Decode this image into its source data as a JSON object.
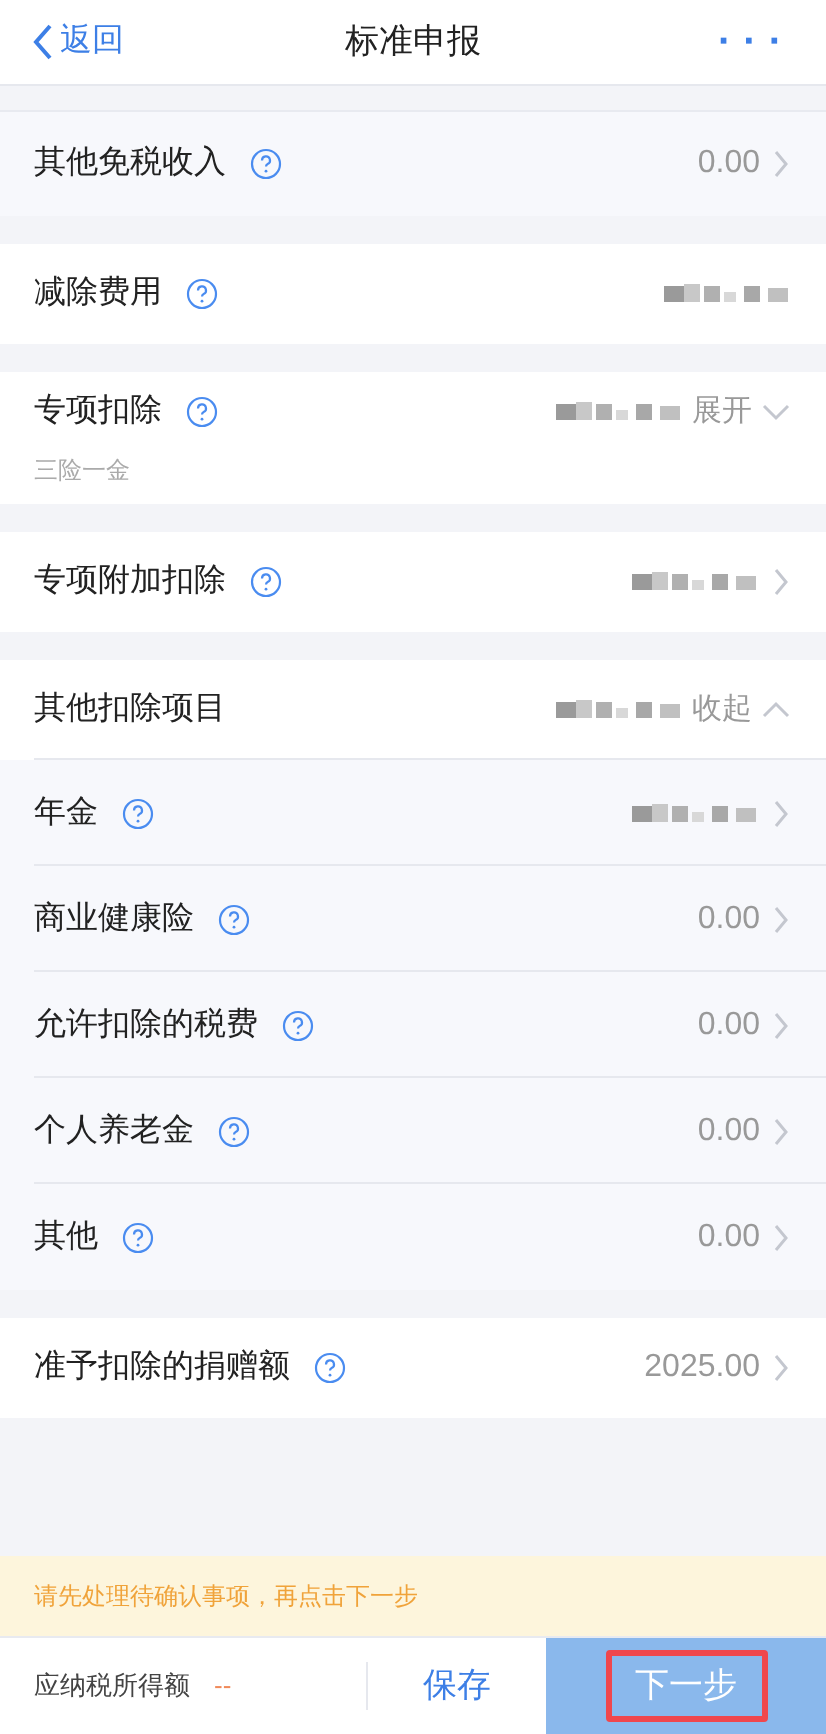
{
  "header": {
    "back": "返回",
    "title": "标准申报",
    "more": "···"
  },
  "rows": [
    {
      "kind": "sub",
      "label": "其他免税收入",
      "help": true,
      "value": "0.00",
      "value_hidden": false,
      "chevron": true,
      "gap_after": true
    },
    {
      "kind": "item",
      "label": "减除费用",
      "help": true,
      "value_hidden": true,
      "chevron": false,
      "gap_after": true
    },
    {
      "kind": "item",
      "label": "专项扣除",
      "help": true,
      "value_hidden": true,
      "subtitle": "三险一金",
      "toggle": {
        "text": "展开",
        "expanded": false
      },
      "chevron": false,
      "gap_after": true
    },
    {
      "kind": "item",
      "label": "专项附加扣除",
      "help": true,
      "value_hidden": true,
      "chevron": true,
      "gap_after": true
    },
    {
      "kind": "item",
      "label": "其他扣除项目",
      "help": false,
      "value_hidden": true,
      "toggle": {
        "text": "收起",
        "expanded": true
      },
      "chevron": false,
      "gap_after": false
    },
    {
      "kind": "sub",
      "label": "年金",
      "help": true,
      "value_hidden": true,
      "chevron": true,
      "gap_after": false
    },
    {
      "kind": "sub",
      "label": "商业健康险",
      "help": true,
      "value": "0.00",
      "value_hidden": false,
      "chevron": true,
      "gap_after": false
    },
    {
      "kind": "sub",
      "label": "允许扣除的税费",
      "help": true,
      "value": "0.00",
      "value_hidden": false,
      "chevron": true,
      "gap_after": false
    },
    {
      "kind": "sub",
      "label": "个人养老金",
      "help": true,
      "value": "0.00",
      "value_hidden": false,
      "chevron": true,
      "gap_after": false
    },
    {
      "kind": "sub",
      "label": "其他",
      "help": true,
      "value": "0.00",
      "value_hidden": false,
      "chevron": true,
      "gap_after": true
    },
    {
      "kind": "item",
      "label": "准予扣除的捐赠额",
      "help": true,
      "value": "2025.00",
      "value_hidden": false,
      "chevron": true,
      "gap_after": false
    }
  ],
  "notice": "请先处理待确认事项，再点击下一步",
  "footer": {
    "taxable_label": "应纳税所得额",
    "taxable_value": "--",
    "save": "保存",
    "next": "下一步",
    "next_highlighted": true
  }
}
